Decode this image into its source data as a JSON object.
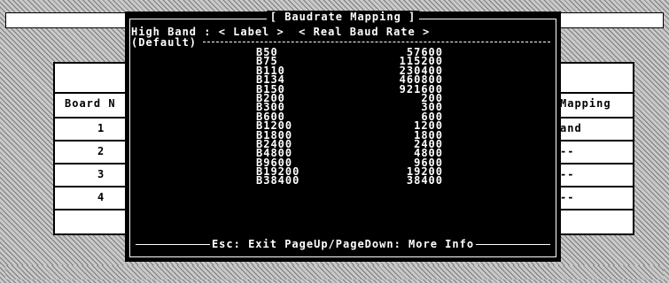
{
  "board_table": {
    "header_left": "Board N",
    "header_right": "Mapping",
    "rows": [
      {
        "number": "1",
        "mapping": "and"
      },
      {
        "number": "2",
        "mapping": "--"
      },
      {
        "number": "3",
        "mapping": "--"
      },
      {
        "number": "4",
        "mapping": "--"
      }
    ]
  },
  "dialog": {
    "title": "[ Baudrate Mapping ]",
    "header_line": "High Band : < Label >  < Real Baud Rate >",
    "default_label": "(Default)",
    "mappings": [
      {
        "label": "B50",
        "rate": "57600"
      },
      {
        "label": "B75",
        "rate": "115200"
      },
      {
        "label": "B110",
        "rate": "230400"
      },
      {
        "label": "B134",
        "rate": "460800"
      },
      {
        "label": "B150",
        "rate": "921600"
      },
      {
        "label": "B200",
        "rate": "200"
      },
      {
        "label": "B300",
        "rate": "300"
      },
      {
        "label": "B600",
        "rate": "600"
      },
      {
        "label": "B1200",
        "rate": "1200"
      },
      {
        "label": "B1800",
        "rate": "1800"
      },
      {
        "label": "B2400",
        "rate": "2400"
      },
      {
        "label": "B4800",
        "rate": "4800"
      },
      {
        "label": "B9600",
        "rate": "9600"
      },
      {
        "label": "B19200",
        "rate": "19200"
      },
      {
        "label": "B38400",
        "rate": "38400"
      }
    ],
    "footer": "Esc: Exit  PageUp/PageDown: More Info"
  }
}
